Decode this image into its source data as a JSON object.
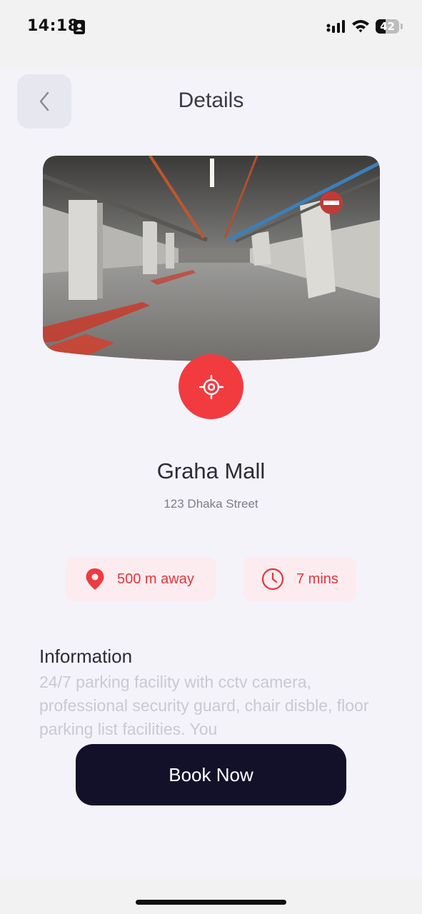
{
  "status_bar": {
    "time": "14:18",
    "battery": "42",
    "battery_level": 0.42
  },
  "header": {
    "title": "Details"
  },
  "place": {
    "name": "Graha Mall",
    "address": "123 Dhaka Street"
  },
  "stats": {
    "distance": "500 m away",
    "time": "7 mins"
  },
  "information": {
    "heading": "Information",
    "body": "24/7 parking facility with cctv camera, professional security guard, chair disble, floor parking list facilities. You"
  },
  "actions": {
    "book_label": "Book Now"
  },
  "colors": {
    "accent": "#f23b3f",
    "chip_background": "#fcecef",
    "primary_button": "#13112a",
    "background": "#f4f3fa"
  },
  "icons": {
    "back": "chevron-left-icon",
    "locate": "crosshair-icon",
    "distance": "map-pin-icon",
    "time": "clock-icon"
  }
}
